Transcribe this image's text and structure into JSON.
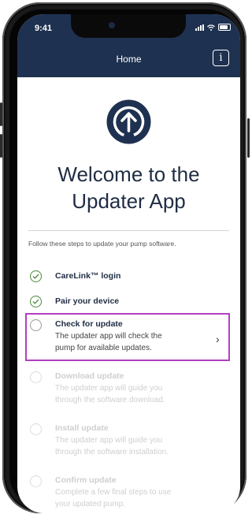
{
  "status_bar": {
    "time": "9:41"
  },
  "header": {
    "title": "Home",
    "info_label": "i"
  },
  "welcome": {
    "line1": "Welcome to the",
    "line2": "Updater App"
  },
  "intro": "Follow these steps to update your pump software.",
  "steps": [
    {
      "title": "CareLink™ login",
      "description": "",
      "state": "done"
    },
    {
      "title": "Pair your device",
      "description": "",
      "state": "done"
    },
    {
      "title": "Check for update",
      "description_1": "The updater app will check the",
      "description_2": "pump for available updates.",
      "state": "current"
    },
    {
      "title": "Download update",
      "description_1": "The updater app will guide you",
      "description_2": "through the software download.",
      "state": "disabled"
    },
    {
      "title": "Install update",
      "description_1": "The updater app will guide you",
      "description_2": "through the software installation.",
      "state": "disabled"
    },
    {
      "title": "Confirm update",
      "description_1": "Complete a few final steps to use",
      "description_2": "your updated pump.",
      "state": "disabled"
    }
  ],
  "colors": {
    "header_bg": "#1f3150",
    "done_check": "#4d8a3a",
    "highlight": "#b13fc0",
    "text": "#1f2c43"
  },
  "icons": [
    "upload-arrow-icon",
    "info-icon",
    "checkmark-icon",
    "chevron-right-icon",
    "signal-icon",
    "wifi-icon",
    "battery-icon"
  ]
}
